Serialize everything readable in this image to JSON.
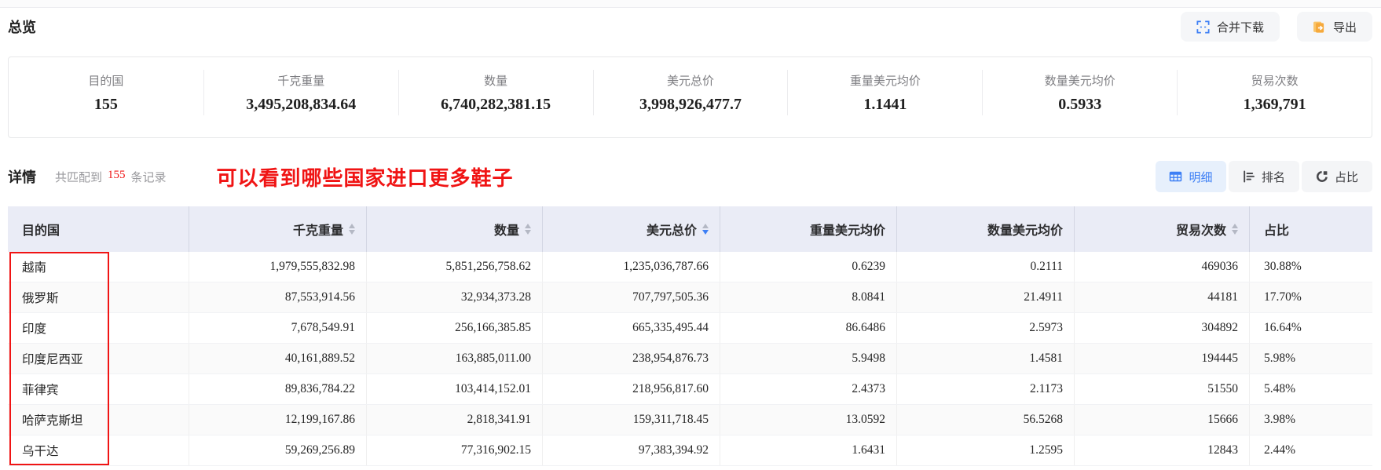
{
  "page": {
    "overview_title": "总览"
  },
  "toolbar": {
    "merge_download": {
      "label": "合并下载",
      "icon": "merge-corners-icon"
    },
    "export": {
      "label": "导出",
      "icon": "export-document-icon"
    }
  },
  "summary": {
    "stats": [
      {
        "label": "目的国",
        "value": "155"
      },
      {
        "label": "千克重量",
        "value": "3,495,208,834.64"
      },
      {
        "label": "数量",
        "value": "6,740,282,381.15"
      },
      {
        "label": "美元总价",
        "value": "3,998,926,477.7"
      },
      {
        "label": "重量美元均价",
        "value": "1.1441"
      },
      {
        "label": "数量美元均价",
        "value": "0.5933"
      },
      {
        "label": "贸易次数",
        "value": "1,369,791"
      }
    ]
  },
  "detail": {
    "title": "详情",
    "match_prefix": "共匹配到",
    "match_count": "155",
    "match_suffix": "条记录",
    "annotation": "可以看到哪些国家进口更多鞋子"
  },
  "view_tabs": [
    {
      "id": "detail",
      "label": "明细",
      "active": true,
      "icon": "table-grid-icon"
    },
    {
      "id": "rank",
      "label": "排名",
      "active": false,
      "icon": "ranking-bars-icon"
    },
    {
      "id": "ratio",
      "label": "占比",
      "active": false,
      "icon": "pie-donut-icon"
    }
  ],
  "table": {
    "columns": [
      {
        "key": "dest-country",
        "label": "目的国",
        "align": "left",
        "sortable": false,
        "sort": null
      },
      {
        "key": "kg-weight",
        "label": "千克重量",
        "align": "right",
        "sortable": true,
        "sort": null
      },
      {
        "key": "quantity",
        "label": "数量",
        "align": "right",
        "sortable": true,
        "sort": null
      },
      {
        "key": "usd-total",
        "label": "美元总价",
        "align": "right",
        "sortable": true,
        "sort": "desc"
      },
      {
        "key": "usd-per-kg",
        "label": "重量美元均价",
        "align": "right",
        "sortable": false,
        "sort": null
      },
      {
        "key": "usd-per-qty",
        "label": "数量美元均价",
        "align": "right",
        "sortable": false,
        "sort": null
      },
      {
        "key": "trade-count",
        "label": "贸易次数",
        "align": "right",
        "sortable": true,
        "sort": null
      },
      {
        "key": "share",
        "label": "占比",
        "align": "left",
        "sortable": false,
        "sort": null
      }
    ],
    "rows": [
      [
        "越南",
        "1,979,555,832.98",
        "5,851,256,758.62",
        "1,235,036,787.66",
        "0.6239",
        "0.2111",
        "469036",
        "30.88%"
      ],
      [
        "俄罗斯",
        "87,553,914.56",
        "32,934,373.28",
        "707,797,505.36",
        "8.0841",
        "21.4911",
        "44181",
        "17.70%"
      ],
      [
        "印度",
        "7,678,549.91",
        "256,166,385.85",
        "665,335,495.44",
        "86.6486",
        "2.5973",
        "304892",
        "16.64%"
      ],
      [
        "印度尼西亚",
        "40,161,889.52",
        "163,885,011.00",
        "238,954,876.73",
        "5.9498",
        "1.4581",
        "194445",
        "5.98%"
      ],
      [
        "菲律宾",
        "89,836,784.22",
        "103,414,152.01",
        "218,956,817.60",
        "2.4373",
        "2.1173",
        "51550",
        "5.48%"
      ],
      [
        "哈萨克斯坦",
        "12,199,167.86",
        "2,818,341.91",
        "159,311,718.45",
        "13.0592",
        "56.5268",
        "15666",
        "3.98%"
      ],
      [
        "乌干达",
        "59,269,256.89",
        "77,316,902.15",
        "97,383,394.92",
        "1.6431",
        "1.2595",
        "12843",
        "2.44%"
      ]
    ]
  },
  "colors": {
    "accent_blue": "#3d7ff5",
    "annotation_red": "#f01414",
    "export_orange": "#f6a93b",
    "header_bg": "#eaecf6"
  }
}
